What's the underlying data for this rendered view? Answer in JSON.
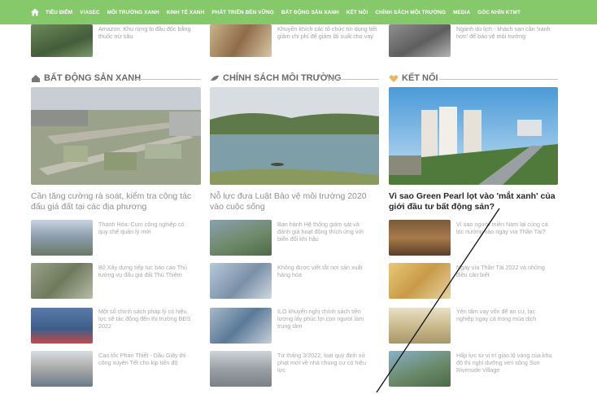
{
  "nav": {
    "home_icon": "home-icon",
    "items": [
      "TIÊU ĐIỂM",
      "VIASEC",
      "MÔI TRƯỜNG XANH",
      "KINH TẾ XANH",
      "PHÁT TRIỂN BỀN VỮNG",
      "BẤT ĐỘNG SẢN XANH",
      "KẾT NỐI",
      "CHÍNH SÁCH MÔI TRƯỜNG",
      "MEDIA",
      "GÓC NHÌN KTMT"
    ]
  },
  "top_row": [
    {
      "text": "Amazon: Khu rừng bị đầu độc bằng thuốc trừ sâu"
    },
    {
      "text": "Khuyến khích các tổ chức tín dụng tiết giảm chi phí để giảm lãi suất cho vay"
    },
    {
      "text": "Ngành du lịch - khách sạn cần 'xanh hơn' để bảo vệ môi trường"
    }
  ],
  "sections": [
    {
      "icon": "house-icon",
      "title": "BẤT ĐỘNG SẢN XANH",
      "hero_title": "Cần tăng cường rà soát, kiểm tra công tác đấu giá đất tại các địa phương",
      "items": [
        "Thanh Hóa: Cụm công nghiệp có quy chế quản lý mới",
        "Bộ Xây dựng tiếp tục báo cáo Thủ tướng vụ đấu giá đất Thủ Thiêm",
        "Một số chính sách pháp lý có hiệu lực sẽ tác động đến thị trường BĐS 2022",
        "Cao tốc Phan Thiết - Dầu Giây thi công xuyên Tết cho kịp tiến độ"
      ]
    },
    {
      "icon": "leaf-icon",
      "title": "CHÍNH SÁCH MÔI TRƯỜNG",
      "hero_title": "Nỗ lực đưa Luật Bảo vệ môi trường 2020 vào cuộc sống",
      "items": [
        "Ban hành Hệ thống giám sát và đánh giá hoạt động thích ứng với biến đổi khí hậu",
        "Không được viết tắt nơi sản xuất hàng hóa",
        "ILO khuyến nghị chính sách tiền lương lấy phúc lợi con người làm trung tâm",
        "Từ tháng 3/2022, loạt quy định xử phạt mới về nhà chung cư có hiệu lực"
      ]
    },
    {
      "icon": "heart-icon",
      "title": "KẾT NỐI",
      "hero_title": "Vì sao Green Pearl lọt vào 'mắt xanh' của giới đầu tư bất động sản?",
      "items": [
        "Vì sao người miền Nam lại cúng cá lóc nướng vào ngày vía Thần Tài?",
        "Ngày vía Thần Tài 2022 và những điều cần biết",
        "Yên tâm vay vốn để an cư, lạc nghiệp ngay cả trong mùa dịch",
        "Hấp lực từ vị trí giao lộ vàng của khu đô thị nghỉ dưỡng ven sông Sun Riverside Village"
      ]
    }
  ],
  "colors": {
    "nav": "#86c96a",
    "section_line": "#e7b7b7",
    "dark_text": "#262626"
  }
}
